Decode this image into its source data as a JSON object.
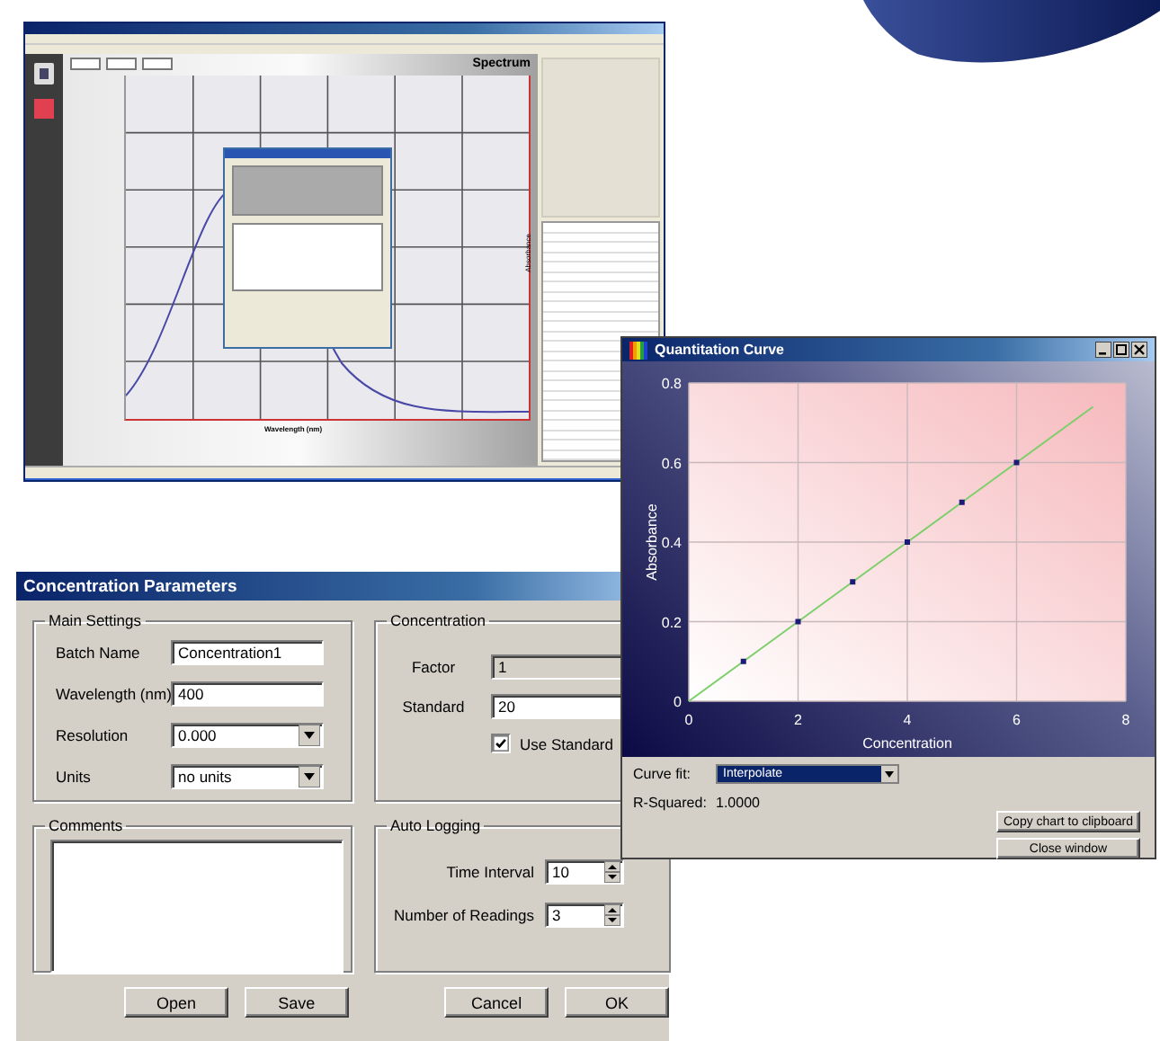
{
  "spectrum_window": {
    "heading": "Spectrum",
    "x_axis_label": "Wavelength (nm)",
    "y_axis_label": "Absorbance"
  },
  "concentration_parameters": {
    "title": "Concentration Parameters",
    "main_settings": {
      "title": "Main Settings",
      "fields": [
        {
          "label": "Batch Name",
          "value": "Concentration1",
          "kind": "text"
        },
        {
          "label": "Wavelength (nm)",
          "value": "400",
          "kind": "text"
        },
        {
          "label": "Resolution",
          "value": "0.000",
          "kind": "dropdown"
        },
        {
          "label": "Units",
          "value": "no units",
          "kind": "dropdown"
        }
      ]
    },
    "concentration": {
      "title": "Concentration",
      "fields": [
        {
          "label": "Factor",
          "value": "1",
          "disabled": true
        },
        {
          "label": "Standard",
          "value": "20",
          "disabled": false
        }
      ],
      "use_standard": {
        "label": "Use Standard",
        "checked": true
      }
    },
    "comments": {
      "title": "Comments"
    },
    "auto_logging": {
      "title": "Auto Logging",
      "fields": [
        {
          "label": "Time Interval",
          "value": "10"
        },
        {
          "label": "Number of Readings",
          "value": "3"
        }
      ]
    },
    "buttons": [
      {
        "label": "Open"
      },
      {
        "label": "Save"
      },
      {
        "label": "Cancel"
      },
      {
        "label": "OK"
      }
    ]
  },
  "quantitation_curve": {
    "title": "Quantitation Curve",
    "chart_data": {
      "type": "scatter",
      "xlabel": "Concentration",
      "ylabel": "Absorbance",
      "grid": true,
      "xlim": [
        0,
        8
      ],
      "ylim": [
        0,
        0.8
      ],
      "xticks": [
        0,
        2,
        4,
        6,
        8
      ],
      "yticks": [
        0,
        0.2,
        0.4,
        0.6,
        0.8
      ],
      "x": [
        0,
        1,
        2,
        3,
        4,
        5,
        6,
        7.4
      ],
      "series": [
        {
          "type": "scatter",
          "color": "#1c1c78",
          "values": [
            null,
            0.1,
            0.2,
            0.3,
            0.4,
            0.5,
            0.6,
            null
          ]
        },
        {
          "type": "line",
          "color": "#7ccf6a",
          "values": [
            0,
            0.1,
            0.2,
            0.3,
            0.4,
            0.5,
            0.6,
            0.74
          ]
        }
      ]
    },
    "curve_fit": {
      "label": "Curve fit:",
      "value": "Interpolate"
    },
    "r_squared": {
      "label": "R-Squared:",
      "value": "1.0000"
    },
    "buttons": [
      "Copy chart to clipboard",
      "Close window"
    ]
  }
}
